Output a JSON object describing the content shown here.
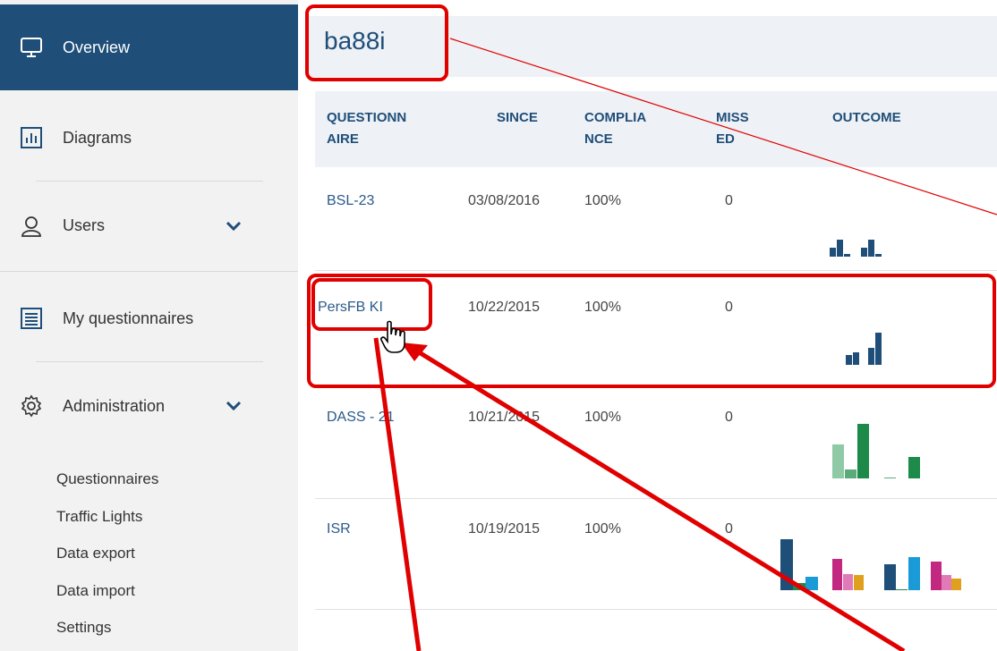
{
  "sidebar": {
    "items": [
      {
        "label": "Overview",
        "icon": "monitor-icon"
      },
      {
        "label": "Diagrams",
        "icon": "bar-chart-icon"
      },
      {
        "label": "Users",
        "icon": "user-icon"
      },
      {
        "label": "My questionnaires",
        "icon": "list-icon"
      },
      {
        "label": "Administration",
        "icon": "gear-icon"
      }
    ],
    "admin_submenu": [
      "Questionnaires",
      "Traffic Lights",
      "Data export",
      "Data import",
      "Settings"
    ],
    "active_color": "#1f4e79"
  },
  "header": {
    "title": "ba88i"
  },
  "table": {
    "headers": {
      "questionnaire": [
        "QUESTIONN",
        "AIRE"
      ],
      "since": "SINCE",
      "compliance": [
        "COMPLIA",
        "NCE"
      ],
      "missed": [
        "MISS",
        "ED"
      ],
      "outcome": "OUTCOME"
    },
    "rows": [
      {
        "name": "BSL-23",
        "since": "03/08/2016",
        "compliance": "100%",
        "missed": "0"
      },
      {
        "name": "PersFB KI",
        "since": "10/22/2015",
        "compliance": "100%",
        "missed": "0"
      },
      {
        "name": "DASS - 21",
        "since": "10/21/2015",
        "compliance": "100%",
        "missed": "0"
      },
      {
        "name": "ISR",
        "since": "10/19/2015",
        "compliance": "100%",
        "missed": "0"
      }
    ]
  },
  "colors": {
    "accent": "#1f4e79",
    "annotation": "#e00000",
    "green_light": "#8fc9a6",
    "green_dark": "#1e8a4a",
    "cyan": "#1a9bd7",
    "magenta": "#c2287f",
    "pink": "#e07bb8",
    "orange": "#e0a01e"
  }
}
